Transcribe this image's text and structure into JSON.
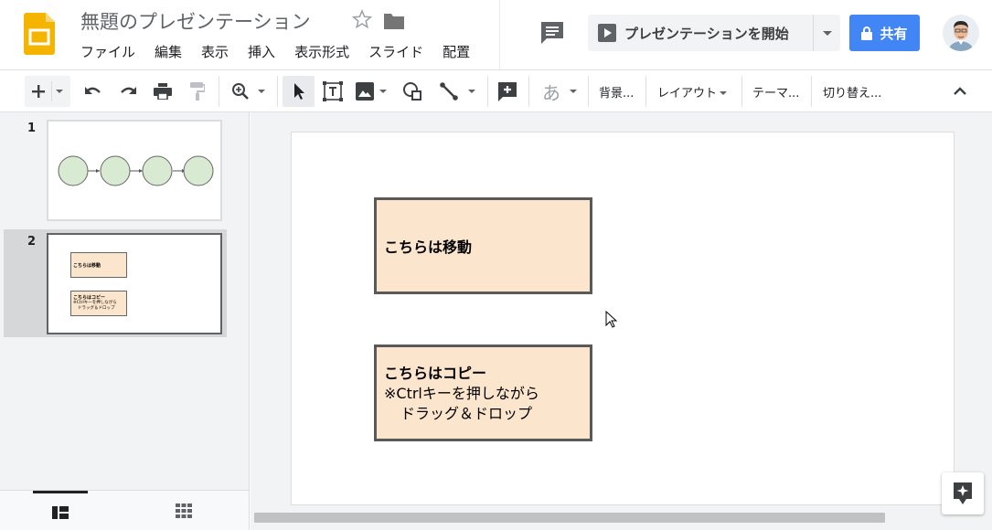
{
  "header": {
    "doc_title": "無題のプレゼンテーション",
    "menu": [
      "ファイル",
      "編集",
      "表示",
      "挿入",
      "表示形式",
      "スライド",
      "配置"
    ],
    "present_label": "プレゼンテーションを開始",
    "share_label": "共有"
  },
  "toolbar": {
    "ime_glyph": "あ",
    "background_label": "背景...",
    "layout_label": "レイアウト",
    "theme_label": "テーマ...",
    "transition_label": "切り替え..."
  },
  "filmstrip": {
    "slides": [
      {
        "number": "1"
      },
      {
        "number": "2",
        "thumb_move_text": "こちらは移動",
        "thumb_copy_title": "こちらはコピー",
        "thumb_copy_line2": "※Ctrlキーを押しながら",
        "thumb_copy_line3": "ドラッグ＆ドロップ"
      }
    ]
  },
  "slide": {
    "shape_move_text": "こちらは移動",
    "shape_copy_title": "こちらはコピー",
    "shape_copy_line2": "※Ctrlキーを押しながら",
    "shape_copy_line3": "ドラッグ＆ドロップ"
  },
  "colors": {
    "logo_yellow": "#f4b400",
    "share_blue": "#4285f4",
    "shape_fill": "#fce5cd",
    "shape_border": "#595959",
    "circle_fill": "#d9ead3",
    "selected_tool_bg": "#e8eaed"
  },
  "icons": [
    "slides-logo-icon",
    "star-icon",
    "folder-icon",
    "comment-icon",
    "play-icon",
    "lock-icon",
    "new-slide-plus-icon",
    "undo-icon",
    "redo-icon",
    "print-icon",
    "paint-format-icon",
    "zoom-icon",
    "select-arrow-icon",
    "text-box-icon",
    "image-icon",
    "shape-icon",
    "line-icon",
    "add-comment-icon",
    "collapse-chevron-icon",
    "list-view-icon",
    "grid-view-icon",
    "explore-icon",
    "mouse-cursor-icon"
  ]
}
